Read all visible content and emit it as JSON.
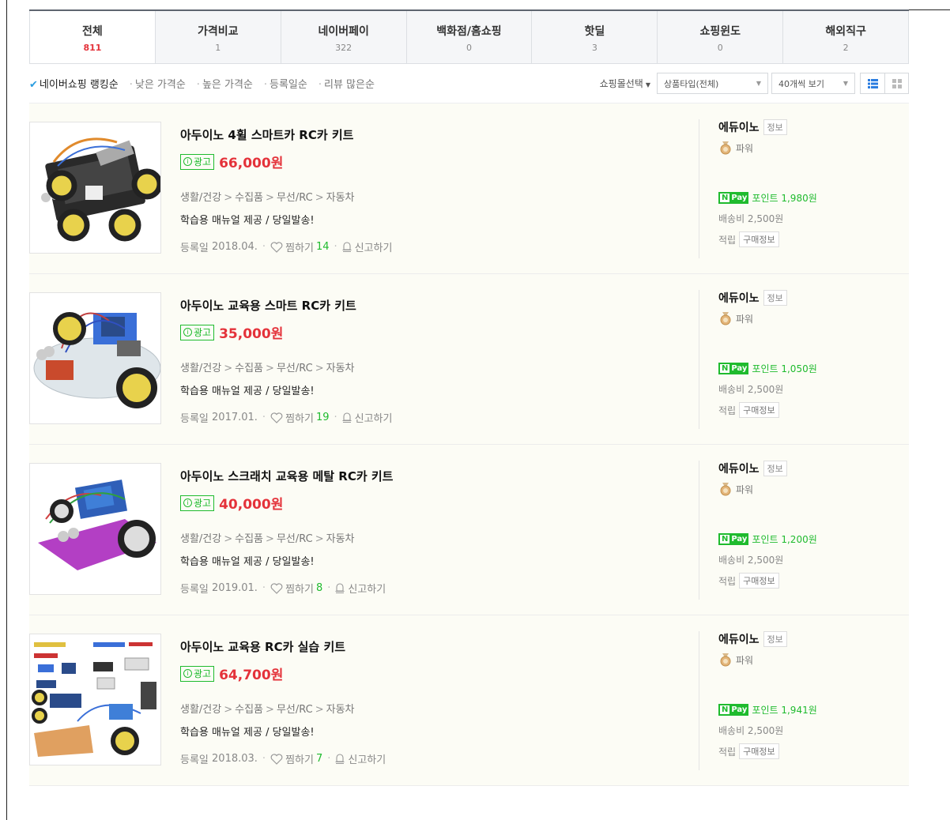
{
  "tabs": [
    {
      "label": "전체",
      "count": "811"
    },
    {
      "label": "가격비교",
      "count": "1"
    },
    {
      "label": "네이버페이",
      "count": "322"
    },
    {
      "label": "백화점/홈쇼핑",
      "count": "0"
    },
    {
      "label": "핫딜",
      "count": "3"
    },
    {
      "label": "쇼핑윈도",
      "count": "0"
    },
    {
      "label": "해외직구",
      "count": "2"
    }
  ],
  "sort": {
    "options": [
      "네이버쇼핑 랭킹순",
      "낮은 가격순",
      "높은 가격순",
      "등록일순",
      "리뷰 많은순"
    ],
    "mall_select": "쇼핑몰선택",
    "product_type": "상품타입(전체)",
    "view_count": "40개씩 보기"
  },
  "common": {
    "ad_label": "광고",
    "info_label": "정보",
    "power_label": "파워",
    "npay_n": "N",
    "npay_label": "Pay",
    "point_prefix": "포인트",
    "earn_label": "적립",
    "purchase_info": "구매정보",
    "reg_prefix": "등록일",
    "wish_label": "찜하기",
    "report_label": "신고하기",
    "accent_green": "#1fbb2e",
    "accent_red": "#e4323a"
  },
  "products": [
    {
      "title": "아두이노 4휠 스마트카 RC카 키트",
      "price": "66,000원",
      "category": [
        "생활/건강",
        "수집품",
        "무선/RC",
        "자동차"
      ],
      "description": "학습용 매뉴얼 제공 / 당일발송!",
      "reg_date": "2018.04.",
      "wish_count": "14",
      "seller": "에듀이노",
      "point": "1,980원",
      "shipping": "배송비 2,500원",
      "image": "rc-car-4wheel-kit"
    },
    {
      "title": "아두이노 교육용 스마트 RC카 키트",
      "price": "35,000원",
      "category": [
        "생활/건강",
        "수집품",
        "무선/RC",
        "자동차"
      ],
      "description": "학습용 매뉴얼 제공 / 당일발송!",
      "reg_date": "2017.01.",
      "wish_count": "19",
      "seller": "에듀이노",
      "point": "1,050원",
      "shipping": "배송비 2,500원",
      "image": "rc-car-acrylic-kit"
    },
    {
      "title": "아두이노 스크래치 교육용 메탈 RC카 키트",
      "price": "40,000원",
      "category": [
        "생활/건강",
        "수집품",
        "무선/RC",
        "자동차"
      ],
      "description": "학습용 매뉴얼 제공 / 당일발송!",
      "reg_date": "2019.01.",
      "wish_count": "8",
      "seller": "에듀이노",
      "point": "1,200원",
      "shipping": "배송비 2,500원",
      "image": "rc-car-metal-kit"
    },
    {
      "title": "아두이노 교육용 RC카 실습 키트",
      "price": "64,700원",
      "category": [
        "생활/건강",
        "수집품",
        "무선/RC",
        "자동차"
      ],
      "description": "학습용 매뉴얼 제공 / 당일발송!",
      "reg_date": "2018.03.",
      "wish_count": "7",
      "seller": "에듀이노",
      "point": "1,941원",
      "shipping": "배송비 2,500원",
      "image": "rc-car-practice-kit"
    }
  ]
}
